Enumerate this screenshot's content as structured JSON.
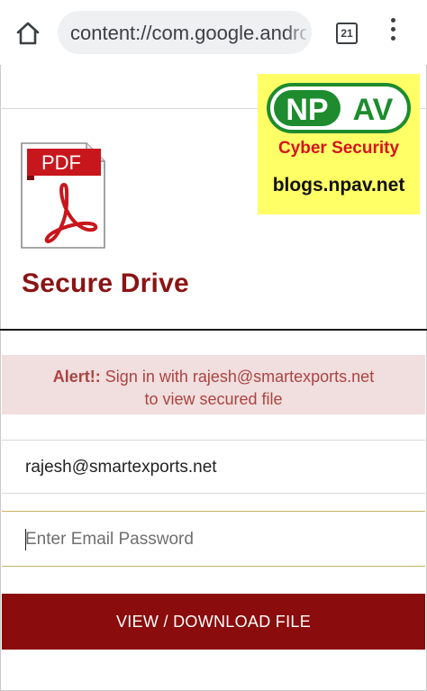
{
  "browser": {
    "url": "content://com.google.android",
    "tab_count": "21"
  },
  "watermark": {
    "logo_left": "NP",
    "logo_right": "AV",
    "subtitle": "Cyber Security",
    "blog": "blogs.npav.net"
  },
  "page": {
    "pdf_badge": "PDF",
    "title": "Secure Drive",
    "alert": {
      "prefix": "Alert!:",
      "message_line1": "Sign in with rajesh@smartexports.net",
      "message_line2": "to view secured file"
    },
    "email_value": "rajesh@smartexports.net",
    "password_placeholder": "Enter Email Password",
    "submit_label": "VIEW / DOWNLOAD FILE"
  },
  "colors": {
    "brand": "#8a1414",
    "button": "#8a0c0c",
    "alert_bg": "#f1dede",
    "alert_text": "#a94442",
    "npav_green": "#1e8c2e",
    "npav_yellow": "#ffff66"
  },
  "icons": [
    "home-icon",
    "tab-switcher-icon",
    "more-vert-icon",
    "pdf-file-icon"
  ]
}
